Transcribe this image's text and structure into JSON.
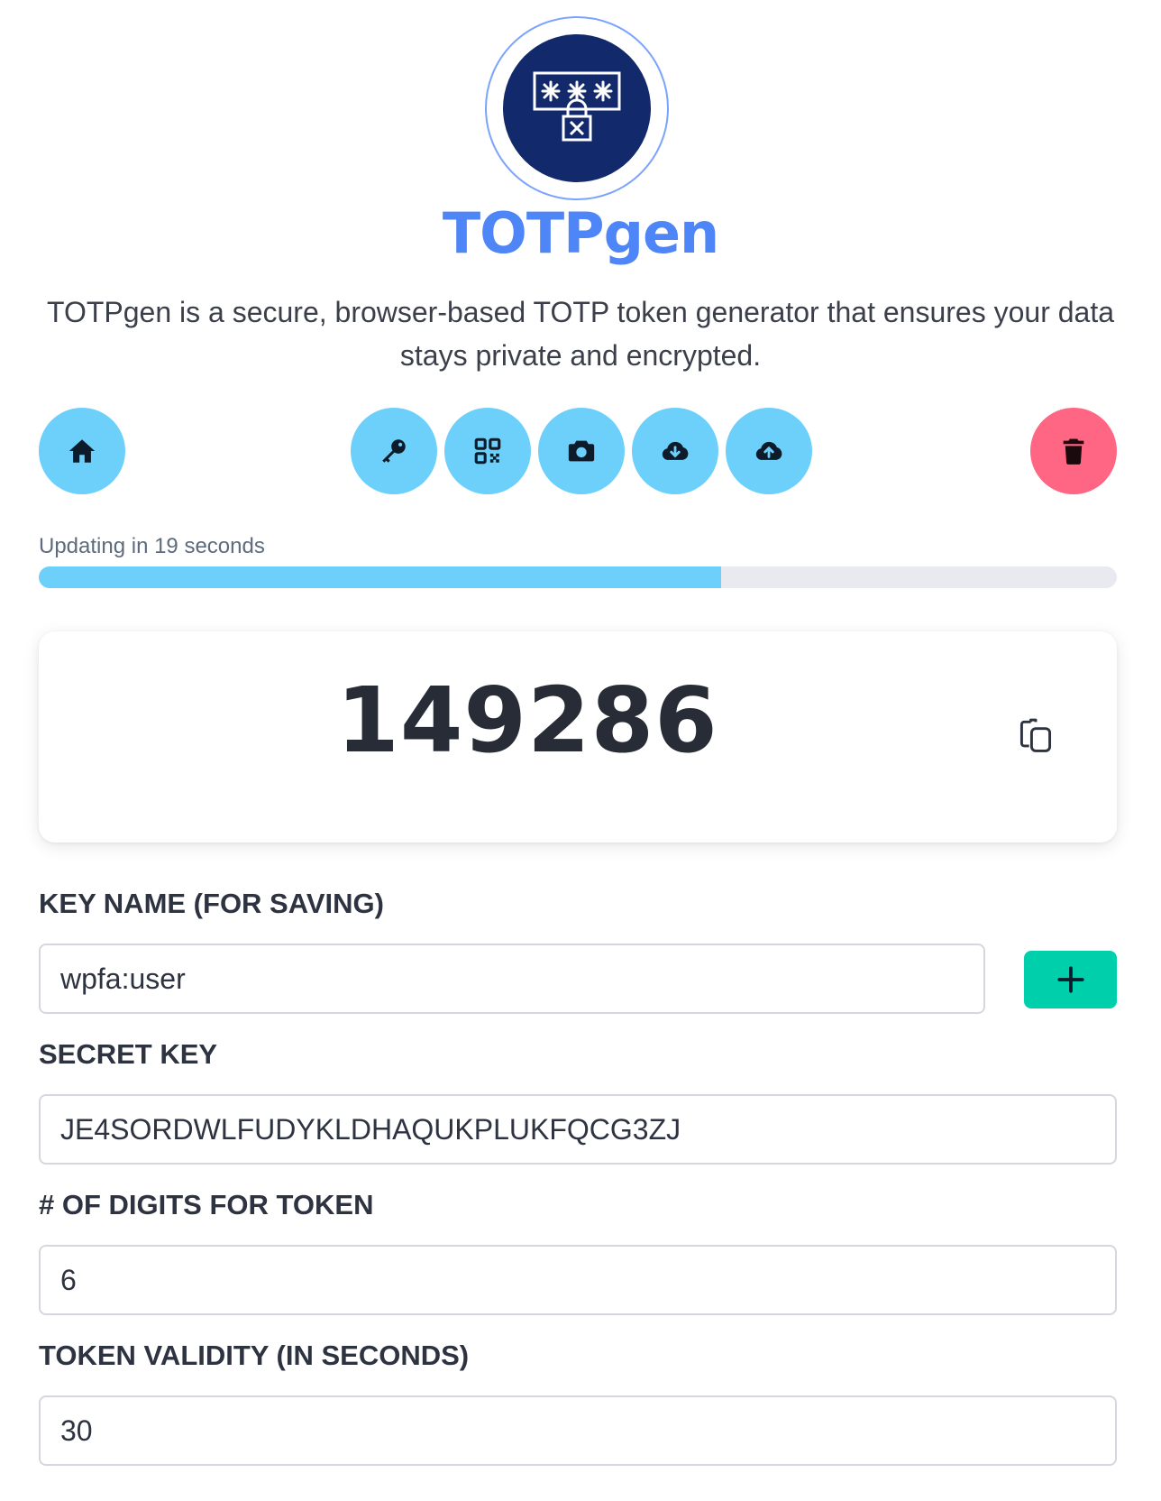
{
  "app": {
    "brand": "TOTPgen",
    "tagline": "TOTPgen is a secure, browser-based TOTP token generator that ensures your data stays private and encrypted."
  },
  "toolbar": {
    "buttons": [
      {
        "name": "home",
        "icon": "home-icon"
      },
      {
        "name": "key",
        "icon": "key-icon"
      },
      {
        "name": "qrcode",
        "icon": "qrcode-icon"
      },
      {
        "name": "camera",
        "icon": "camera-icon"
      },
      {
        "name": "download",
        "icon": "cloud-download-icon"
      },
      {
        "name": "upload",
        "icon": "cloud-upload-icon"
      },
      {
        "name": "delete",
        "icon": "trash-icon"
      }
    ]
  },
  "timer": {
    "label": "Updating in 19 seconds",
    "progress_fraction": 0.633
  },
  "token": {
    "value": "149286"
  },
  "form": {
    "key_name_label": "KEY NAME (FOR SAVING)",
    "key_name_value": "wpfa:user",
    "secret_label": "SECRET KEY",
    "secret_value": "JE4SORDWLFUDYKLDHAQUKPLUKFQCG3ZJ",
    "digits_label": "# OF DIGITS FOR TOKEN",
    "digits_value": "6",
    "validity_label": "TOKEN VALIDITY (IN SECONDS)",
    "validity_value": "30"
  },
  "colors": {
    "accent": "#6cd0fb",
    "danger": "#ff6683",
    "success": "#00cfac",
    "brand": "#4f86f7",
    "logo_bg": "#12296b"
  }
}
